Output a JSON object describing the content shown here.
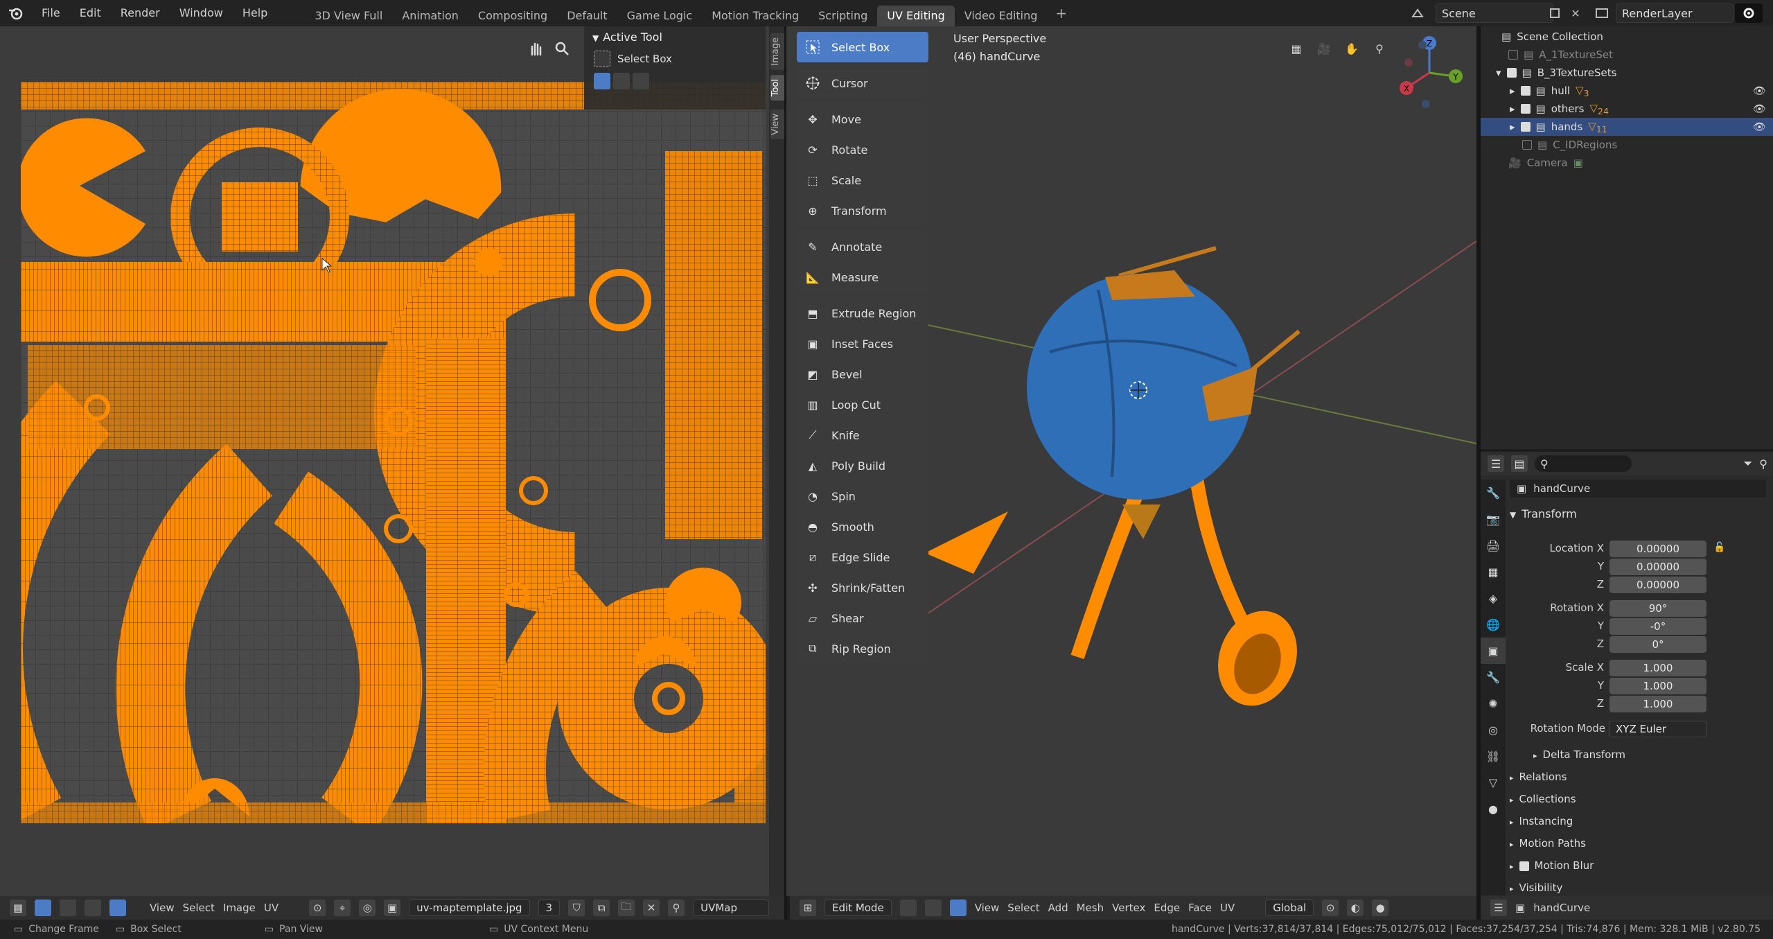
{
  "menu": [
    "File",
    "Edit",
    "Render",
    "Window",
    "Help"
  ],
  "workspaces": [
    "3D View Full",
    "Animation",
    "Compositing",
    "Default",
    "Game Logic",
    "Motion Tracking",
    "Scripting",
    "UV Editing",
    "Video Editing"
  ],
  "active_workspace_index": 7,
  "scene_name": "Scene",
  "render_layer": "RenderLayer",
  "uv_editor": {
    "side_tabs": [
      "Image",
      "Tool",
      "View"
    ],
    "active_tool": {
      "header": "Active Tool",
      "tool": "Select Box"
    },
    "header": {
      "menus": [
        "View",
        "Select",
        "Image",
        "UV"
      ],
      "image_name": "uv-maptemplate.jpg",
      "image_users": "3",
      "uv_map": "UVMap"
    }
  },
  "toolbar": [
    {
      "label": "Select Box",
      "icon": "select-box-icon",
      "active": true
    },
    {
      "label": "Cursor",
      "icon": "cursor-icon"
    },
    {
      "label": "Move",
      "icon": "move-icon"
    },
    {
      "label": "Rotate",
      "icon": "rotate-icon"
    },
    {
      "label": "Scale",
      "icon": "scale-icon"
    },
    {
      "label": "Transform",
      "icon": "transform-icon"
    },
    {
      "label": "Annotate",
      "icon": "annotate-icon"
    },
    {
      "label": "Measure",
      "icon": "measure-icon"
    },
    {
      "label": "Extrude Region",
      "icon": "extrude-icon"
    },
    {
      "label": "Inset Faces",
      "icon": "inset-icon"
    },
    {
      "label": "Bevel",
      "icon": "bevel-icon"
    },
    {
      "label": "Loop Cut",
      "icon": "loop-cut-icon"
    },
    {
      "label": "Knife",
      "icon": "knife-icon"
    },
    {
      "label": "Poly Build",
      "icon": "poly-build-icon"
    },
    {
      "label": "Spin",
      "icon": "spin-icon"
    },
    {
      "label": "Smooth",
      "icon": "smooth-icon"
    },
    {
      "label": "Edge Slide",
      "icon": "edge-slide-icon"
    },
    {
      "label": "Shrink/Fatten",
      "icon": "shrink-fatten-icon"
    },
    {
      "label": "Shear",
      "icon": "shear-icon"
    },
    {
      "label": "Rip Region",
      "icon": "rip-region-icon"
    }
  ],
  "viewport": {
    "perspective": "User Perspective",
    "object_info": "(46) handCurve",
    "header": {
      "mode": "Edit Mode",
      "menus": [
        "View",
        "Select",
        "Add",
        "Mesh",
        "Vertex",
        "Edge",
        "Face",
        "UV"
      ],
      "orientation": "Global"
    },
    "gizmo_axes": [
      "X",
      "Y",
      "Z"
    ]
  },
  "outliner": {
    "items": [
      {
        "label": "Scene Collection",
        "level": 0
      },
      {
        "label": "A_1TextureSet",
        "level": 1,
        "checked": false,
        "dim": true
      },
      {
        "label": "B_3TextureSets",
        "level": 1,
        "checked": true
      },
      {
        "label": "hull",
        "level": 2,
        "checked": true,
        "count": "3"
      },
      {
        "label": "others",
        "level": 2,
        "checked": true,
        "count": "24"
      },
      {
        "label": "hands",
        "level": 2,
        "checked": true,
        "count": "11",
        "selected": true
      },
      {
        "label": "C_IDRegions",
        "level": 1,
        "checked": false,
        "dim": true
      },
      {
        "label": "Camera",
        "level": 1,
        "dim": true
      }
    ]
  },
  "properties": {
    "object_name": "handCurve",
    "transform_header": "Transform",
    "location": {
      "label": "Location X",
      "x": "0.00000",
      "y": "0.00000",
      "z": "0.00000"
    },
    "rotation": {
      "label": "Rotation X",
      "x": "90°",
      "y": "-0°",
      "z": "0°"
    },
    "scale": {
      "label": "Scale X",
      "x": "1.000",
      "y": "1.000",
      "z": "1.000"
    },
    "axis_labels": {
      "y": "Y",
      "z": "Z"
    },
    "rotation_mode_label": "Rotation Mode",
    "rotation_mode": "XYZ Euler",
    "sections": [
      "Delta Transform",
      "Relations",
      "Collections",
      "Instancing",
      "Motion Paths",
      "Motion Blur",
      "Visibility"
    ],
    "footer_object": "handCurve"
  },
  "status_bar": {
    "items": [
      "Change Frame",
      "Box Select",
      "Pan View",
      "UV Context Menu"
    ],
    "stats": "handCurve | Verts:37,814/37,814 | Edges:75,012/75,012 | Faces:37,254/37,254 | Tris:74,876 | Mem: 328.1 MiB | v2.80.75"
  },
  "colors": {
    "accent": "#4d7cc7",
    "uv_island": "#ff8c00",
    "hull_blue": "#2f6fb8",
    "selected_row": "#334d80"
  }
}
